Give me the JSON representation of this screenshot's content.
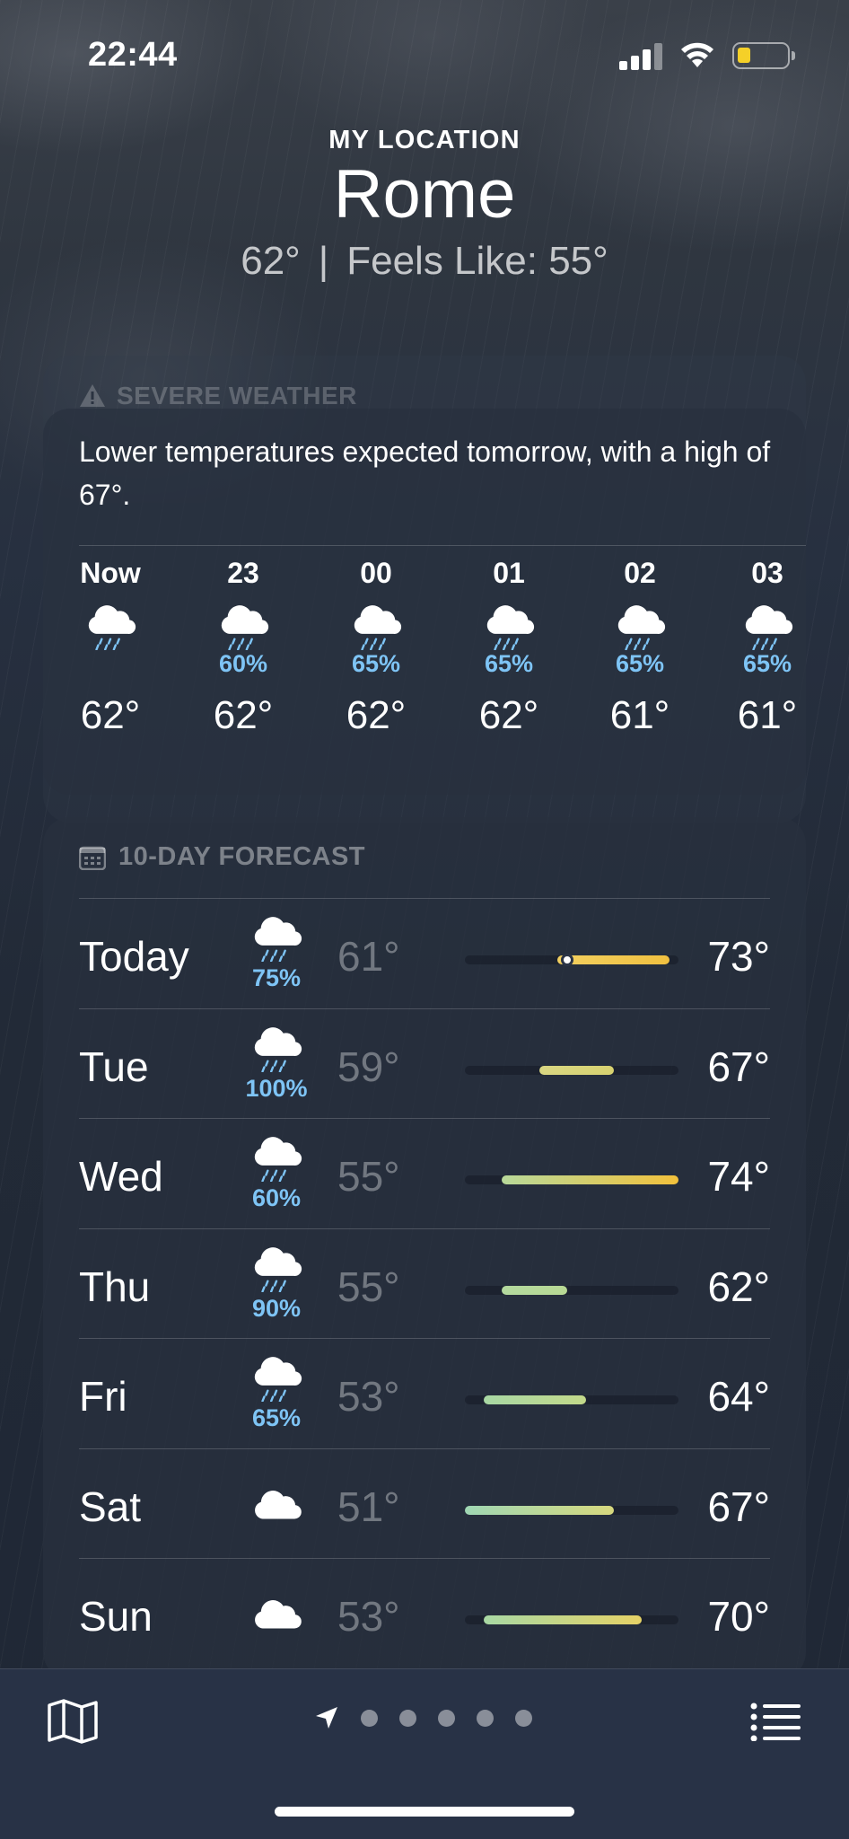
{
  "status_bar": {
    "time": "22:44",
    "battery_color": "#f5d028"
  },
  "header": {
    "location_label": "MY LOCATION",
    "city": "Rome",
    "current_temp": "62°",
    "separator": "|",
    "feels_like": "Feels Like: 55°"
  },
  "alert": {
    "label": "SEVERE WEATHER",
    "text": "Lower temperatures expected tomorrow, with a high of 67°."
  },
  "hourly": [
    {
      "label": "Now",
      "icon": "rain-cloud-icon",
      "pop": "",
      "temp": "62°"
    },
    {
      "label": "23",
      "icon": "rain-cloud-icon",
      "pop": "60%",
      "temp": "62°"
    },
    {
      "label": "00",
      "icon": "rain-cloud-icon",
      "pop": "65%",
      "temp": "62°"
    },
    {
      "label": "01",
      "icon": "rain-cloud-icon",
      "pop": "65%",
      "temp": "62°"
    },
    {
      "label": "02",
      "icon": "rain-cloud-icon",
      "pop": "65%",
      "temp": "61°"
    },
    {
      "label": "03",
      "icon": "rain-cloud-icon",
      "pop": "65%",
      "temp": "61°"
    }
  ],
  "forecast": {
    "label": "10-DAY FORECAST",
    "range_min": 51,
    "range_max": 74,
    "current_temp_value": 62,
    "days": [
      {
        "day": "Today",
        "icon": "rain-cloud-icon",
        "pop": "75%",
        "low": "61°",
        "high": "73°",
        "low_val": 61,
        "high_val": 73,
        "colors": [
          "#f2d060",
          "#f0c040"
        ],
        "show_current": true
      },
      {
        "day": "Tue",
        "icon": "rain-cloud-icon",
        "pop": "100%",
        "low": "59°",
        "high": "67°",
        "low_val": 59,
        "high_val": 67,
        "colors": [
          "#d9d783",
          "#d8d270"
        ],
        "show_current": false
      },
      {
        "day": "Wed",
        "icon": "rain-cloud-icon",
        "pop": "60%",
        "low": "55°",
        "high": "74°",
        "low_val": 55,
        "high_val": 74,
        "colors": [
          "#b8d99a",
          "#f2c13c"
        ],
        "show_current": false
      },
      {
        "day": "Thu",
        "icon": "rain-cloud-icon",
        "pop": "90%",
        "low": "55°",
        "high": "62°",
        "low_val": 55,
        "high_val": 62,
        "colors": [
          "#b3d99e",
          "#b8d994"
        ],
        "show_current": false
      },
      {
        "day": "Fri",
        "icon": "rain-cloud-icon",
        "pop": "65%",
        "low": "53°",
        "high": "64°",
        "low_val": 53,
        "high_val": 64,
        "colors": [
          "#a8d8a4",
          "#c3d98a"
        ],
        "show_current": false
      },
      {
        "day": "Sat",
        "icon": "cloud-icon",
        "pop": "",
        "low": "51°",
        "high": "67°",
        "low_val": 51,
        "high_val": 67,
        "colors": [
          "#9fd7b4",
          "#d7d87e"
        ],
        "show_current": false
      },
      {
        "day": "Sun",
        "icon": "cloud-icon",
        "pop": "",
        "low": "53°",
        "high": "70°",
        "low_val": 53,
        "high_val": 70,
        "colors": [
          "#a8d8a4",
          "#e6d266"
        ],
        "show_current": false
      }
    ]
  },
  "toolbar": {
    "page_count": 5
  }
}
